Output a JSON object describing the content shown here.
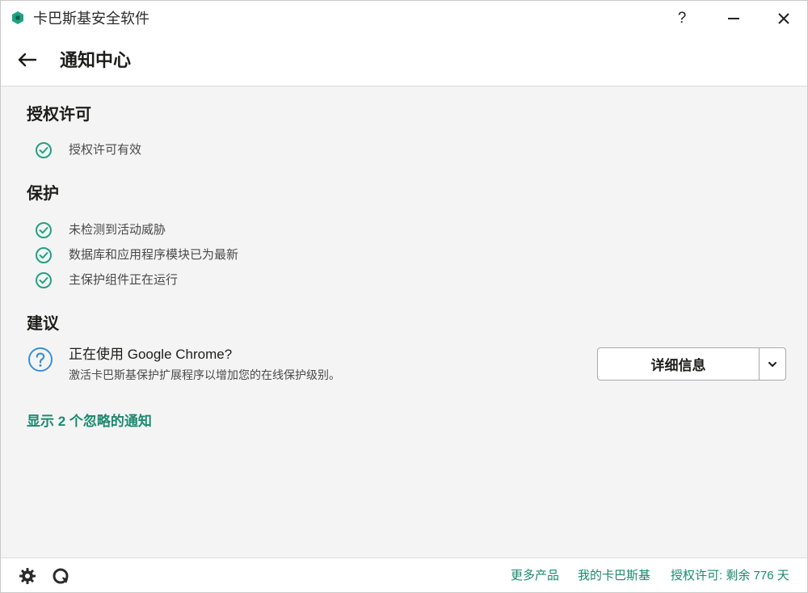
{
  "window": {
    "title": "卡巴斯基安全软件",
    "help": "?"
  },
  "header": {
    "title": "通知中心"
  },
  "sections": {
    "license": {
      "title": "授权许可",
      "items": [
        "授权许可有效"
      ]
    },
    "protection": {
      "title": "保护",
      "items": [
        "未检测到活动威胁",
        "数据库和应用程序模块已为最新",
        "主保护组件正在运行"
      ]
    },
    "recommendation": {
      "title": "建议",
      "heading": "正在使用 Google Chrome?",
      "description": "激活卡巴斯基保护扩展程序以增加您的在线保护级别。",
      "button_label": "详细信息"
    }
  },
  "ignored_link": "显示 2 个忽略的通知",
  "footer": {
    "more_products": "更多产品",
    "my_kaspersky": "我的卡巴斯基",
    "license_status": "授权许可: 剩余 776 天"
  },
  "colors": {
    "accent": "#1a8a6f",
    "check": "#1fa383",
    "info": "#3b8fd4",
    "background": "#f4f4f4"
  },
  "icons": [
    "kaspersky-logo",
    "help",
    "minimize",
    "close",
    "back-arrow",
    "check-circle",
    "question-circle",
    "chevron-down",
    "gear",
    "support"
  ]
}
